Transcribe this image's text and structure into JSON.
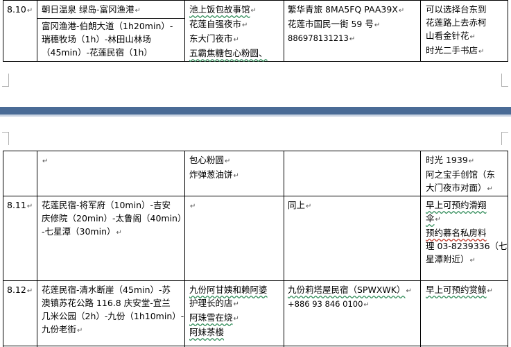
{
  "rows_top": [
    {
      "date": "8.10",
      "route_a": "朝日温泉   绿岛-富冈渔港",
      "route_b": [
        "富冈渔港-伯朗大道（1h20min）-",
        "瑞穗牧场（1h）-林田山林场",
        "（45min）-花莲民宿（1h）"
      ],
      "food": [
        "池上饭包故事馆",
        "花莲自强夜市",
        "东大门夜市",
        "五霸焦糖包心粉圆、"
      ],
      "lodging": [
        "繁华青旅 8MA5FQ    PAA39X",
        "",
        "花莲市国民一街 59 号",
        "886978131213"
      ],
      "notes": [
        "可以选择台东到",
        "花莲路上去赤柯",
        "山看金针花",
        "时光二手书店"
      ]
    }
  ],
  "rows_bottom": [
    {
      "date": "",
      "route": [
        ""
      ],
      "food": [
        "包心粉圆",
        "炸弹葱油饼"
      ],
      "lodging": [
        ""
      ],
      "notes": [
        "时光 1939",
        "阿之宝手创馆（东",
        "大门夜市对面）"
      ]
    },
    {
      "date": "8.11",
      "route": [
        "花莲民宿-将军府（10min）-吉安",
        "庆修院（20min）-太鲁阁（40min）",
        "-七星潭（30min）"
      ],
      "food": [
        ""
      ],
      "lodging": [
        "同上"
      ],
      "notes": [
        "早上可预约滑翔",
        "伞",
        "预约慕名私房料",
        "理 03-8239336（七",
        "星潭附近）"
      ]
    },
    {
      "date": "8.12",
      "route": [
        "花莲民宿-清水断崖（45min）-苏",
        "澳镇苏花公路 116.8 庆安堂-宜兰",
        "几米公园（2h）-九份（1h10min）-",
        "九份老街"
      ],
      "food": [
        "九份阿甘姨和赖阿婆",
        "护理长的店",
        "阿珠雪在烧",
        "阿妹茶楼"
      ],
      "lodging": [
        "九份莉塔屋民宿（SPWXWK）",
        "",
        "+886 93 846 0100"
      ],
      "notes": [
        "早上可预约赏鲸"
      ]
    }
  ],
  "colors": {
    "page_gap": "#ffffff",
    "separator_band": "#4a6b96",
    "spellcheck_green": "#2e8b57",
    "spellcheck_red": "#c0392b"
  },
  "icons": [
    "paragraph-return-mark",
    "page-corner-mark"
  ]
}
